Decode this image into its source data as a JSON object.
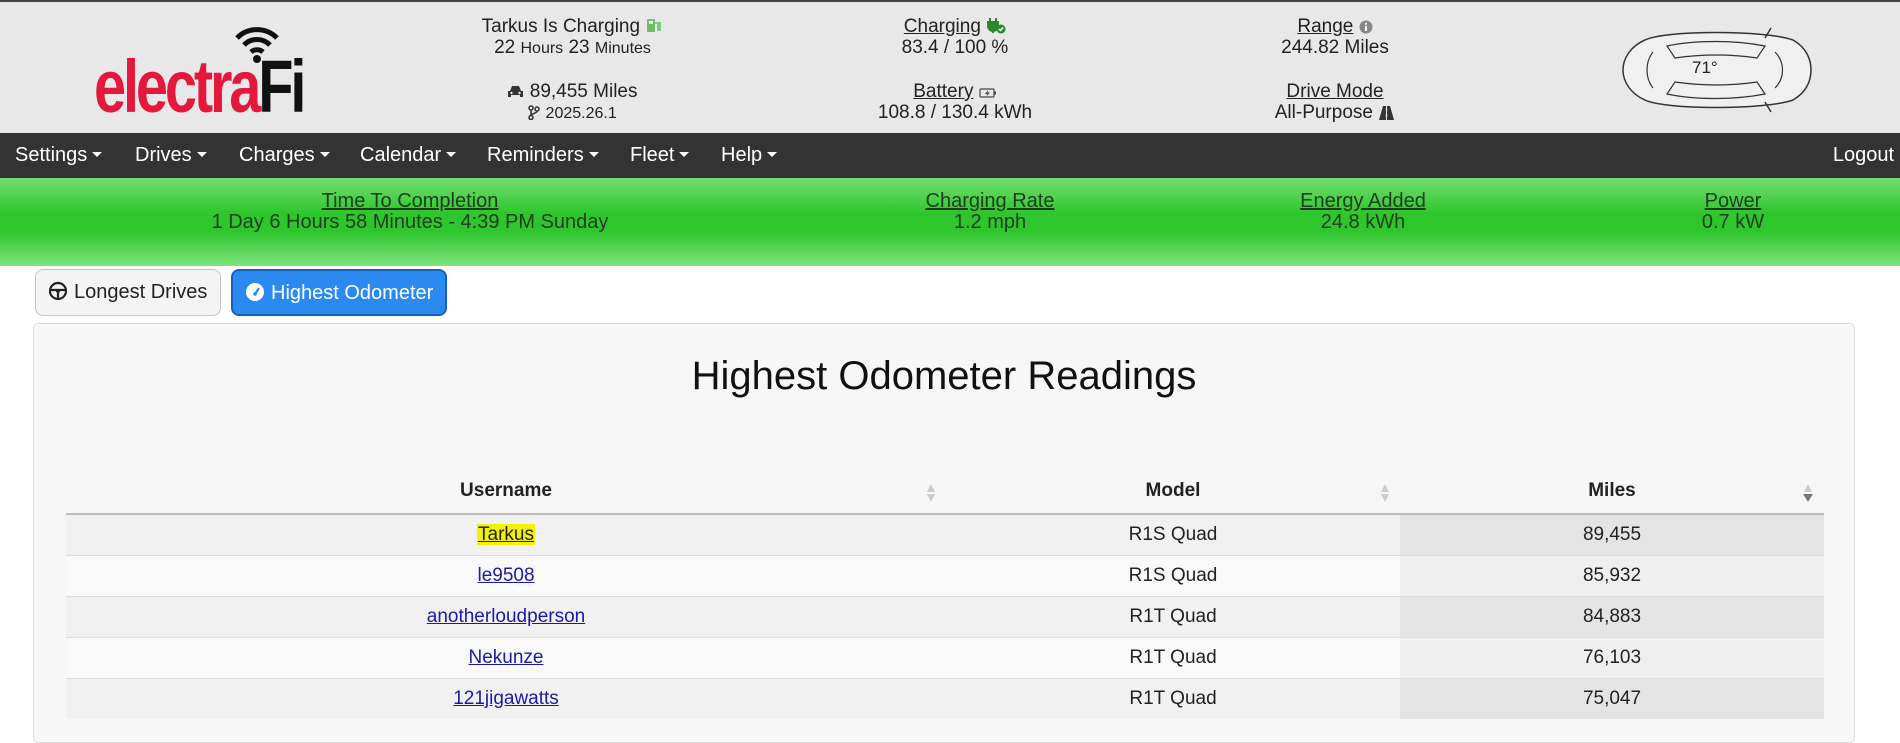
{
  "logo": {
    "brand_red": "electra",
    "brand_dark": "Fi"
  },
  "header": {
    "vehicle_status": "Tarkus Is Charging",
    "time_hours": "22",
    "time_hours_unit": "Hours",
    "time_minutes": "23",
    "time_minutes_unit": "Minutes",
    "odometer": "89,455 Miles",
    "software_version": "2025.26.1",
    "charging_label": "Charging",
    "charging_value": "83.4 / 100 %",
    "battery_label": "Battery",
    "battery_value": "108.8 / 130.4 kWh",
    "range_label": "Range",
    "range_value": "244.82 Miles",
    "drive_mode_label": "Drive Mode",
    "drive_mode_value": "All-Purpose",
    "cabin_temp": "71°"
  },
  "nav": {
    "items": [
      "Settings",
      "Drives",
      "Charges",
      "Calendar",
      "Reminders",
      "Fleet",
      "Help"
    ],
    "logout": "Logout"
  },
  "charging_bar": {
    "time_to_completion_label": "Time To Completion",
    "time_to_completion_value": "1 Day 6 Hours 58 Minutes - 4:39 PM Sunday",
    "charging_rate_label": "Charging Rate",
    "charging_rate_value": "1.2 mph",
    "energy_added_label": "Energy Added",
    "energy_added_value": "24.8 kWh",
    "power_label": "Power",
    "power_value": "0.7 kW"
  },
  "tabs": {
    "longest_drives": "Longest Drives",
    "highest_odometer": "Highest Odometer"
  },
  "card": {
    "title": "Highest Odometer Readings"
  },
  "table": {
    "columns": [
      "Username",
      "Model",
      "Miles"
    ],
    "rows": [
      {
        "username": "Tarkus",
        "model": "R1S Quad",
        "miles": "89,455"
      },
      {
        "username": "le9508",
        "model": "R1S Quad",
        "miles": "85,932"
      },
      {
        "username": "anotherloudperson",
        "model": "R1T Quad",
        "miles": "84,883"
      },
      {
        "username": "Nekunze",
        "model": "R1T Quad",
        "miles": "76,103"
      },
      {
        "username": "121jigawatts",
        "model": "R1T Quad",
        "miles": "75,047"
      }
    ]
  },
  "colors": {
    "brand_red": "#e4173c",
    "nav_bg": "#333333",
    "charging_green": "#2fc62d",
    "active_tab": "#2b8af0",
    "link": "#1a1aa6",
    "highlight": "#f3f300"
  }
}
